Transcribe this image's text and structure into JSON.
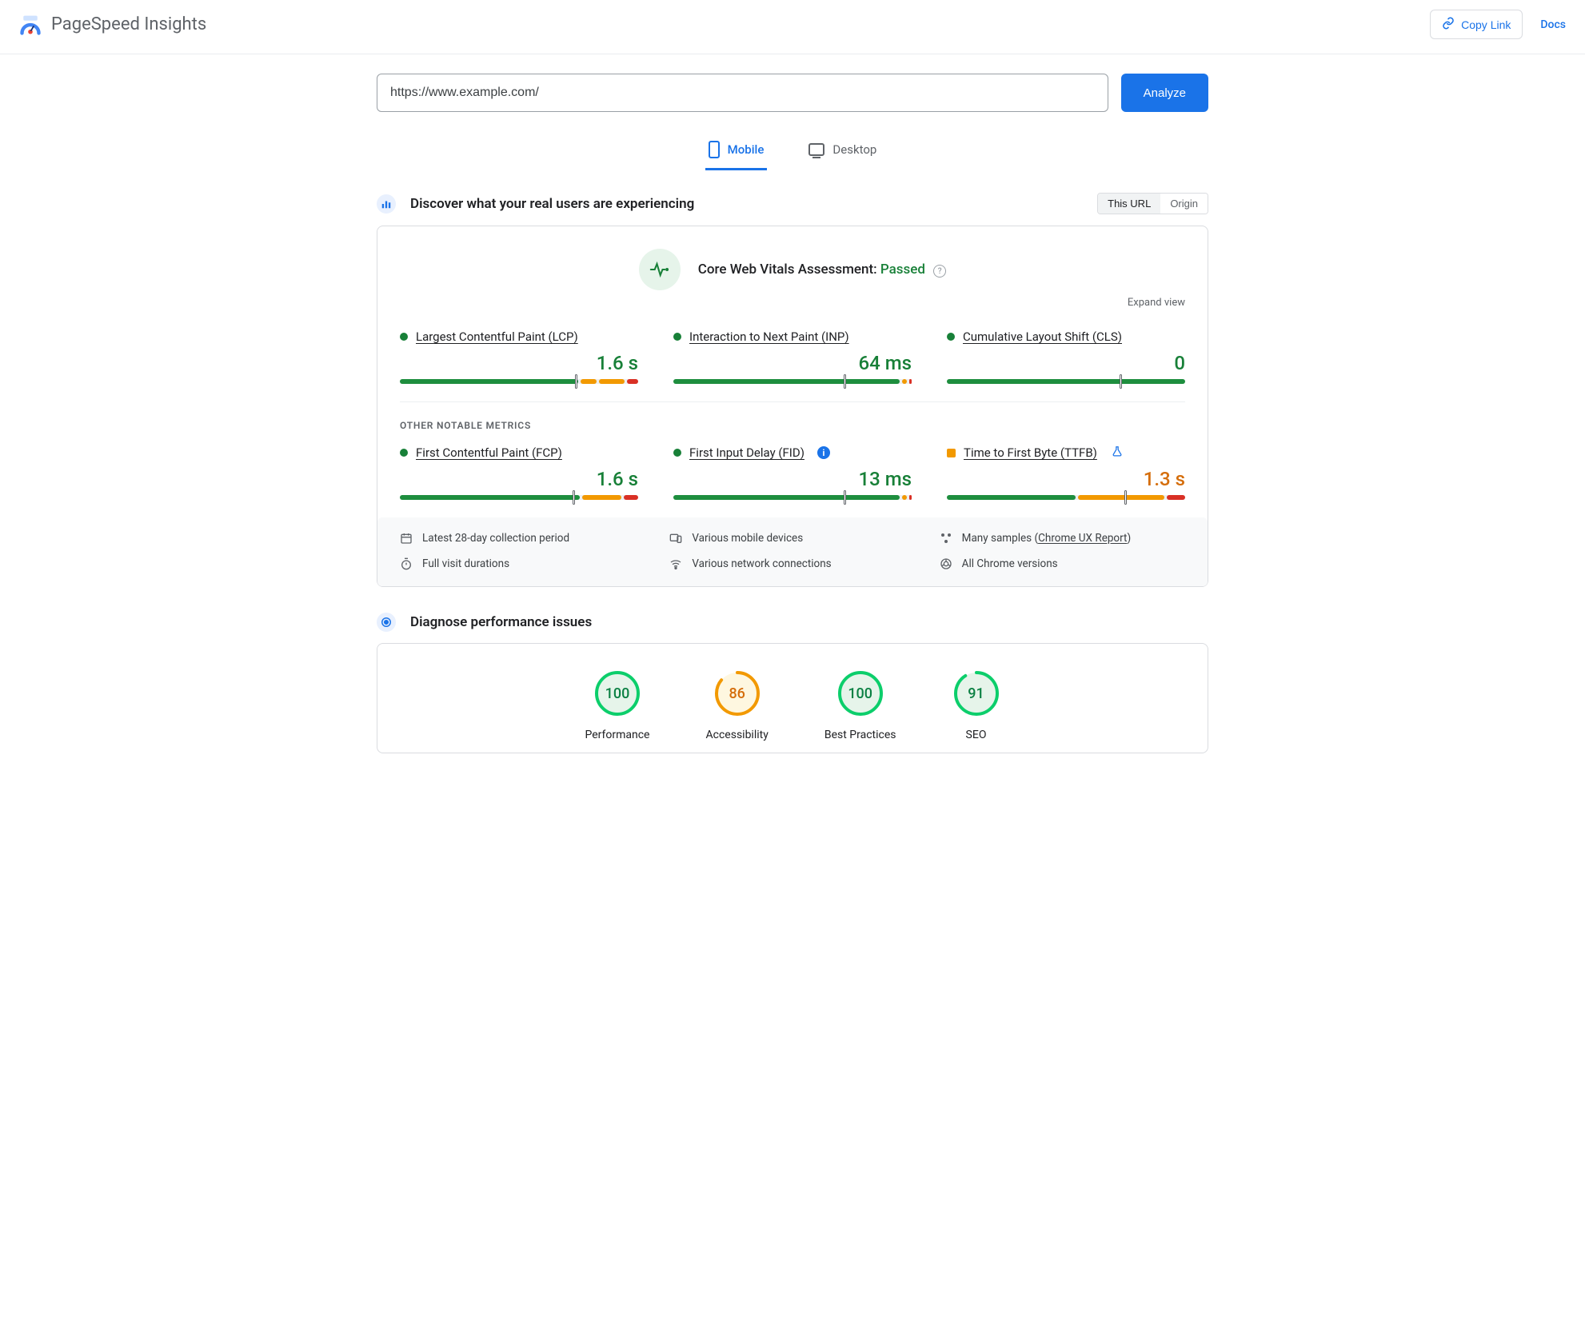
{
  "app": {
    "title": "PageSpeed Insights"
  },
  "header": {
    "copy_link": "Copy Link",
    "docs": "Docs"
  },
  "input": {
    "url": "https://www.example.com/",
    "analyze": "Analyze"
  },
  "tabs": {
    "mobile": "Mobile",
    "desktop": "Desktop",
    "active": "mobile"
  },
  "discover": {
    "title": "Discover what your real users are experiencing",
    "seg_this_url": "This URL",
    "seg_origin": "Origin"
  },
  "cwv": {
    "label": "Core Web Vitals Assessment: ",
    "status": "Passed",
    "expand": "Expand view"
  },
  "metrics_top": [
    {
      "name": "Largest Contentful Paint (LCP)",
      "value": "1.6 s",
      "status": "good",
      "bar": {
        "g": 74,
        "o": 7,
        "o2": 11,
        "r": 5,
        "marker": 74
      }
    },
    {
      "name": "Interaction to Next Paint (INP)",
      "value": "64 ms",
      "status": "good",
      "bar": {
        "g": 97,
        "o": 2,
        "r": 1,
        "marker": 72
      }
    },
    {
      "name": "Cumulative Layout Shift (CLS)",
      "value": "0",
      "status": "good",
      "bar": {
        "g": 100,
        "o": 0,
        "r": 0,
        "marker": 73
      }
    }
  ],
  "other_label": "OTHER NOTABLE METRICS",
  "metrics_bottom": [
    {
      "name": "First Contentful Paint (FCP)",
      "value": "1.6 s",
      "status": "good",
      "bar": {
        "g": 75,
        "o": 17,
        "r": 6,
        "marker": 73
      },
      "extra": null
    },
    {
      "name": "First Input Delay (FID)",
      "value": "13 ms",
      "status": "good",
      "bar": {
        "g": 97,
        "o": 2,
        "r": 1,
        "marker": 72
      },
      "extra": "info"
    },
    {
      "name": "Time to First Byte (TTFB)",
      "value": "1.3 s",
      "status": "warn",
      "bar": {
        "g": 53,
        "o": 37,
        "r": 8,
        "marker": 75
      },
      "extra": "flask"
    }
  ],
  "meta": {
    "period": "Latest 28-day collection period",
    "devices": "Various mobile devices",
    "samples_pre": "Many samples (",
    "samples_link": "Chrome UX Report",
    "samples_post": ")",
    "durations": "Full visit durations",
    "network": "Various network connections",
    "versions": "All Chrome versions"
  },
  "diagnose": {
    "title": "Diagnose performance issues"
  },
  "scores": [
    {
      "label": "Performance",
      "value": "100",
      "num": 100,
      "color": "#0cce6b",
      "track": "#e6f4ea",
      "text": "#0b8043"
    },
    {
      "label": "Accessibility",
      "value": "86",
      "num": 86,
      "color": "#f29900",
      "track": "#fef7e0",
      "text": "#d56e0c"
    },
    {
      "label": "Best Practices",
      "value": "100",
      "num": 100,
      "color": "#0cce6b",
      "track": "#e6f4ea",
      "text": "#0b8043"
    },
    {
      "label": "SEO",
      "value": "91",
      "num": 91,
      "color": "#0cce6b",
      "track": "#e6f4ea",
      "text": "#0b8043"
    }
  ]
}
